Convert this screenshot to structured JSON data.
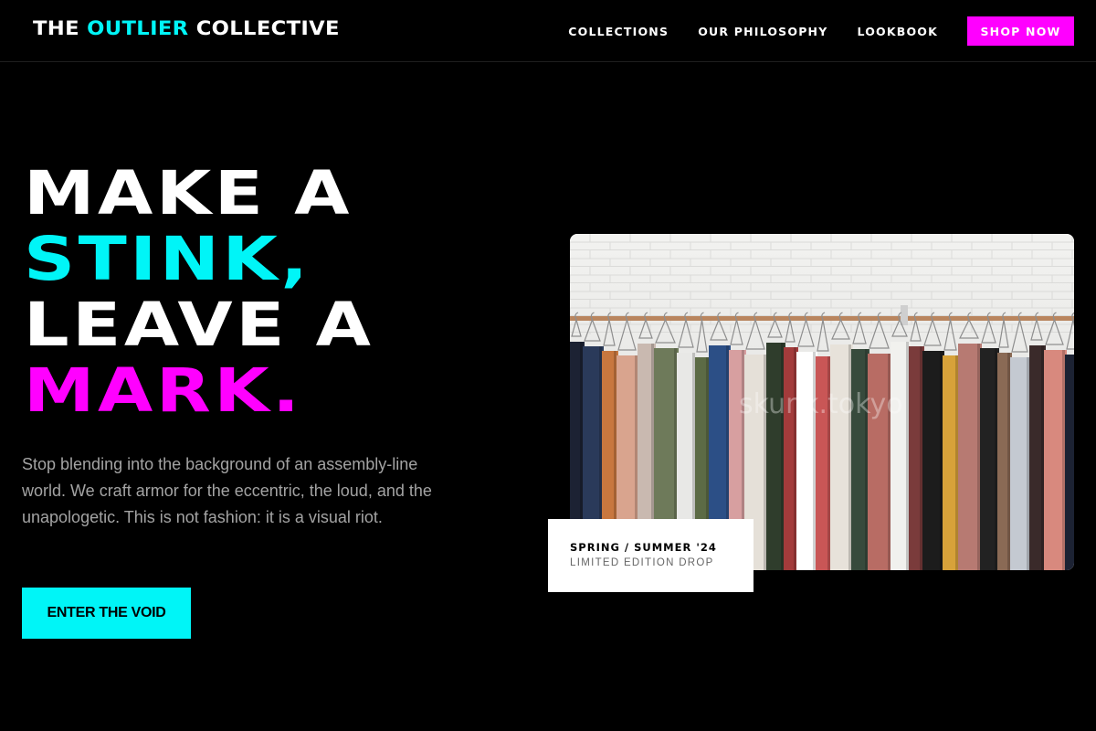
{
  "header": {
    "logo_pre": "THE",
    "logo_accent": "OUTLIER",
    "logo_post": "COLLECTIVE",
    "nav": {
      "collections": "COLLECTIONS",
      "philosophy": "OUR PHILOSOPHY",
      "lookbook": "LOOKBOOK"
    },
    "shop_label": "SHOP NOW"
  },
  "hero": {
    "line1": "MAKE A",
    "line2": "STINK,",
    "line3": "LEAVE A",
    "line4": "MARK.",
    "subtext": "Stop blending into the background of an assembly-line world. We craft armor for the eccentric, the loud, and the unapologetic. This is not fashion: it is a visual riot.",
    "cta_label": "ENTER THE VOID"
  },
  "feature": {
    "watermark": "skunk.tokyo",
    "caption_title": "SPRING / SUMMER '24",
    "caption_sub": "LIMITED EDITION DROP"
  },
  "colors": {
    "background": "#000000",
    "cyan": "#00f5f7",
    "magenta": "#ff00ff",
    "muted_text": "#a3a3a3"
  }
}
